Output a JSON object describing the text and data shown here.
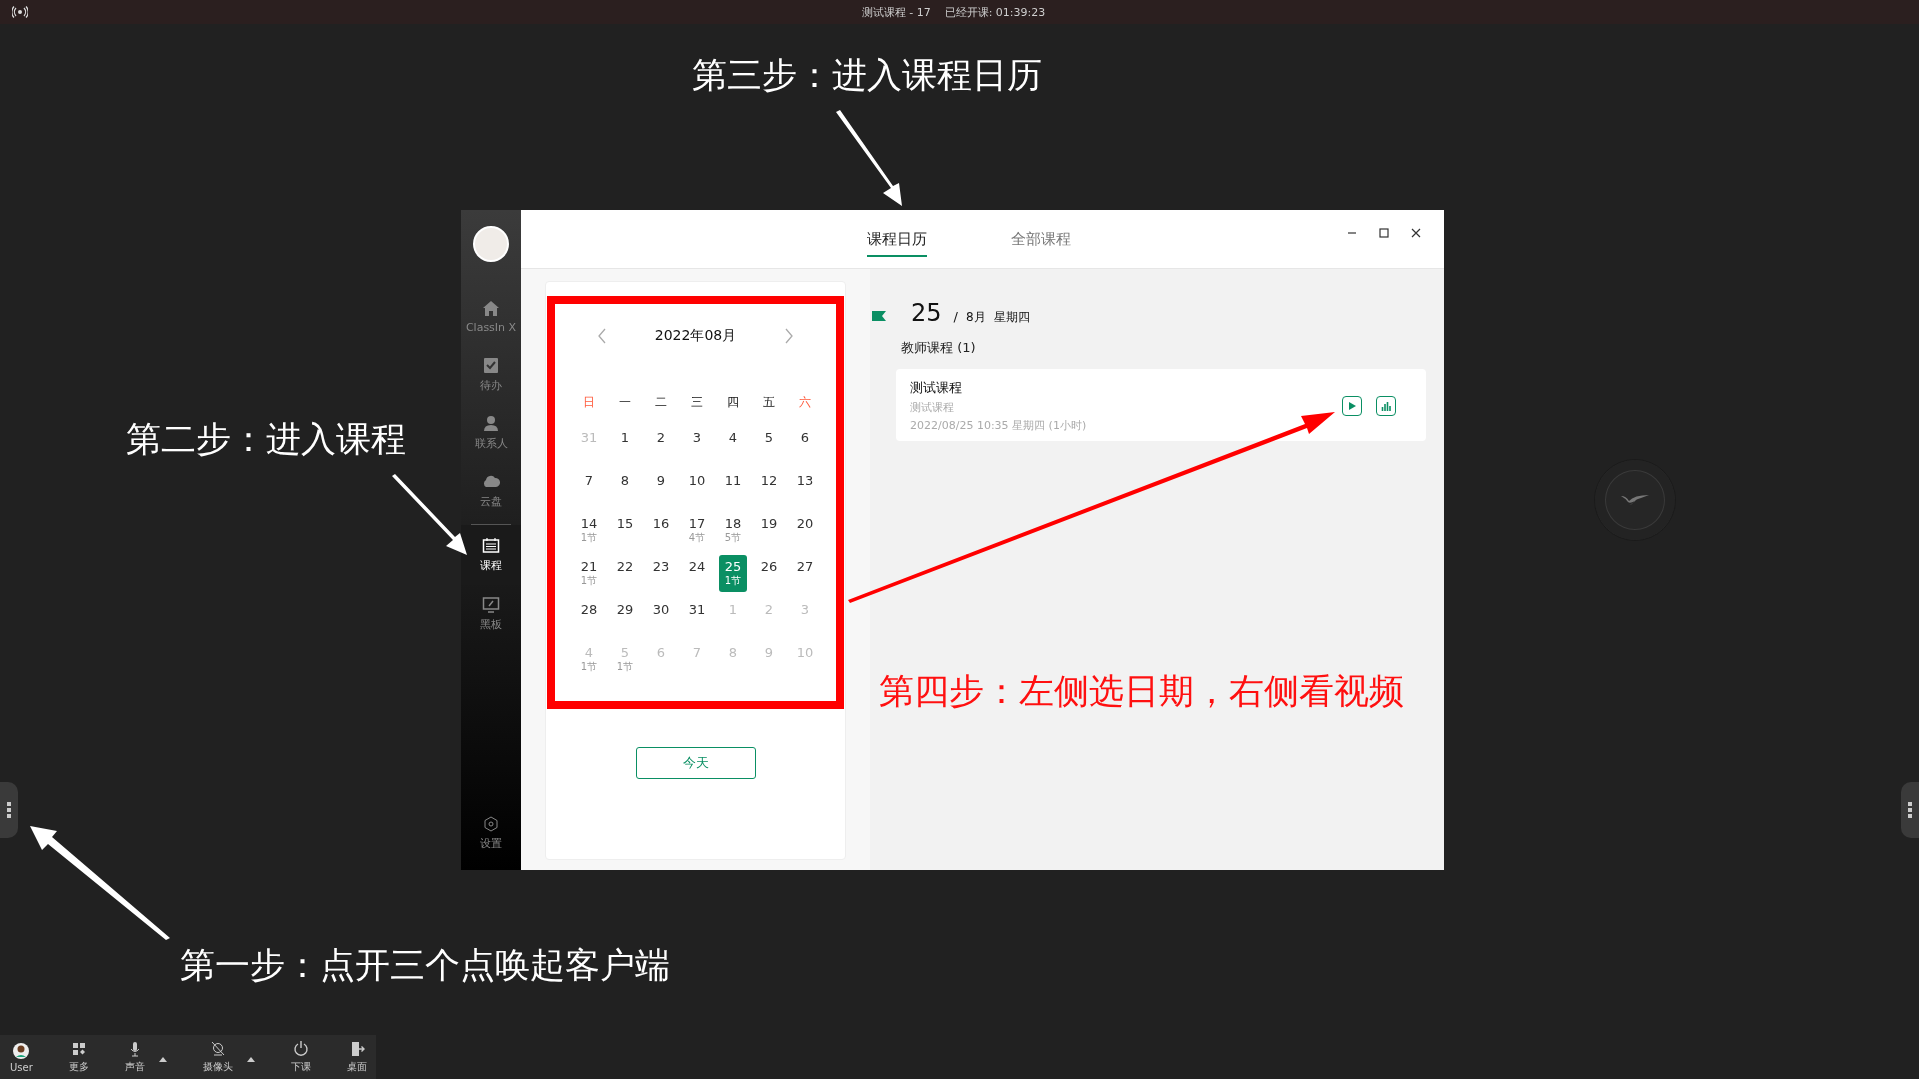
{
  "top_bar": {
    "title": "测试课程 - 17",
    "elapsed": "已经开课: 01:39:23"
  },
  "annotations": [
    {
      "text": "第三步：进入课程日历",
      "color": "#ffffff"
    },
    {
      "text": "第二步：进入课程",
      "color": "#ffffff"
    },
    {
      "text": "第四步：左侧选日期，右侧看视频",
      "color": "#ff1010"
    },
    {
      "text": "第一步：点开三个点唤起客户端",
      "color": "#ffffff"
    }
  ],
  "sidebar": {
    "items": [
      {
        "label": "ClassIn X",
        "selected": false
      },
      {
        "label": "待办",
        "selected": false
      },
      {
        "label": "联系人",
        "selected": false
      },
      {
        "label": "云盘",
        "selected": false
      },
      {
        "label": "课程",
        "selected": true
      },
      {
        "label": "黑板",
        "selected": false
      }
    ],
    "settings": "设置"
  },
  "tabs": [
    {
      "label": "课程日历",
      "selected": true
    },
    {
      "label": "全部课程",
      "selected": false
    }
  ],
  "calendar": {
    "month": "2022年08月",
    "weekdays": [
      {
        "label": "日",
        "kind": "weekend"
      },
      {
        "label": "一",
        "kind": "weekday"
      },
      {
        "label": "二",
        "kind": "weekday"
      },
      {
        "label": "三",
        "kind": "weekday"
      },
      {
        "label": "四",
        "kind": "weekday"
      },
      {
        "label": "五",
        "kind": "weekday"
      },
      {
        "label": "六",
        "kind": "weekend"
      }
    ],
    "days": [
      {
        "day": "31",
        "muted": true,
        "selected": false
      },
      {
        "day": "1",
        "muted": false,
        "selected": false
      },
      {
        "day": "2",
        "muted": false,
        "selected": false
      },
      {
        "day": "3",
        "muted": false,
        "selected": false
      },
      {
        "day": "4",
        "muted": false,
        "selected": false
      },
      {
        "day": "5",
        "muted": false,
        "selected": false
      },
      {
        "day": "6",
        "muted": false,
        "selected": false
      },
      {
        "day": "7",
        "muted": false,
        "selected": false
      },
      {
        "day": "8",
        "muted": false,
        "selected": false
      },
      {
        "day": "9",
        "muted": false,
        "selected": false
      },
      {
        "day": "10",
        "muted": false,
        "selected": false
      },
      {
        "day": "11",
        "muted": false,
        "selected": false
      },
      {
        "day": "12",
        "muted": false,
        "selected": false
      },
      {
        "day": "13",
        "muted": false,
        "selected": false
      },
      {
        "day": "14",
        "lessons": "1节",
        "muted": false,
        "selected": false
      },
      {
        "day": "15",
        "muted": false,
        "selected": false
      },
      {
        "day": "16",
        "muted": false,
        "selected": false
      },
      {
        "day": "17",
        "lessons": "4节",
        "muted": false,
        "selected": false
      },
      {
        "day": "18",
        "lessons": "5节",
        "muted": false,
        "selected": false
      },
      {
        "day": "19",
        "muted": false,
        "selected": false
      },
      {
        "day": "20",
        "muted": false,
        "selected": false
      },
      {
        "day": "21",
        "lessons": "1节",
        "muted": false,
        "selected": false
      },
      {
        "day": "22",
        "muted": false,
        "selected": false
      },
      {
        "day": "23",
        "muted": false,
        "selected": false
      },
      {
        "day": "24",
        "muted": false,
        "selected": false
      },
      {
        "day": "25",
        "lessons": "1节",
        "muted": false,
        "selected": true
      },
      {
        "day": "26",
        "muted": false,
        "selected": false
      },
      {
        "day": "27",
        "muted": false,
        "selected": false
      },
      {
        "day": "28",
        "muted": false,
        "selected": false
      },
      {
        "day": "29",
        "muted": false,
        "selected": false
      },
      {
        "day": "30",
        "muted": false,
        "selected": false
      },
      {
        "day": "31",
        "muted": false,
        "selected": false
      },
      {
        "day": "1",
        "muted": true,
        "selected": false
      },
      {
        "day": "2",
        "muted": true,
        "selected": false
      },
      {
        "day": "3",
        "muted": true,
        "selected": false
      },
      {
        "day": "4",
        "lessons": "1节",
        "muted": true,
        "selected": false
      },
      {
        "day": "5",
        "lessons": "1节",
        "muted": true,
        "selected": false
      },
      {
        "day": "6",
        "muted": true,
        "selected": false
      },
      {
        "day": "7",
        "muted": true,
        "selected": false
      },
      {
        "day": "8",
        "muted": true,
        "selected": false
      },
      {
        "day": "9",
        "muted": true,
        "selected": false
      },
      {
        "day": "10",
        "muted": true,
        "selected": false
      }
    ],
    "today_button": "今天"
  },
  "detail": {
    "day": "25",
    "separator": "/",
    "month": "8月",
    "weekday": "星期四",
    "section": "教师课程 (1)",
    "courses": [
      {
        "title": "测试课程",
        "subtitle": "测试课程",
        "time": "2022/08/25 10:35 星期四 (1小时)"
      }
    ]
  },
  "toolbar": {
    "items": [
      {
        "label": "User",
        "kind": "avatar",
        "has_menu": false
      },
      {
        "label": "更多",
        "kind": "grid",
        "has_menu": false
      },
      {
        "label": "声音",
        "kind": "mic",
        "has_menu": true
      },
      {
        "label": "摄像头",
        "kind": "camera",
        "has_menu": true
      },
      {
        "label": "下课",
        "kind": "power",
        "has_menu": false
      },
      {
        "label": "桌面",
        "kind": "exit",
        "has_menu": false
      }
    ]
  }
}
